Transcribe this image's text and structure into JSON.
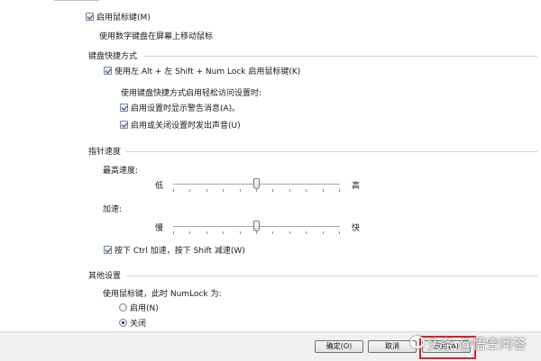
{
  "mouse_keys": {
    "enable_label": "启用鼠标键(M)",
    "enable_checked": true,
    "description": "使用数字键盘在屏幕上移动鼠标"
  },
  "keyboard_shortcut": {
    "group_title": "键盘快捷方式",
    "shortcut_label": "使用左 Alt + 左 Shift + Num Lock 启用鼠标键(K)",
    "shortcut_checked": true,
    "sub_heading": "使用键盘快捷方式启用轻松访问设置时:",
    "warning_label": "启用设置时显示警告消息(A)。",
    "warning_checked": true,
    "sound_label": "启用或关闭设置时发出声音(U)",
    "sound_checked": true
  },
  "pointer_speed": {
    "group_title": "指针速度",
    "top_speed_label": "最高速度:",
    "top_speed_low": "低",
    "top_speed_high": "高",
    "top_speed_value": 0.5,
    "accel_label": "加速:",
    "accel_low": "慢",
    "accel_high": "快",
    "accel_value": 0.5,
    "ctrl_shift_label": "按下 Ctrl 加速，按下 Shift 减速(W)",
    "ctrl_shift_checked": true
  },
  "other_settings": {
    "group_title": "其他设置",
    "numlock_prompt": "使用鼠标键，此时 NumLock 为:",
    "option_on": "启用(N)",
    "option_off": "关闭",
    "selected": "关闭"
  },
  "footer": {
    "ok_label": "确定(O)",
    "cancel_label": "取消",
    "apply_label": "应用(A)"
  },
  "watermark": {
    "text": "头条 @悟空问答"
  },
  "colors": {
    "highlight_box": "#e11d24",
    "footer_bg": "#f0f0f0"
  }
}
